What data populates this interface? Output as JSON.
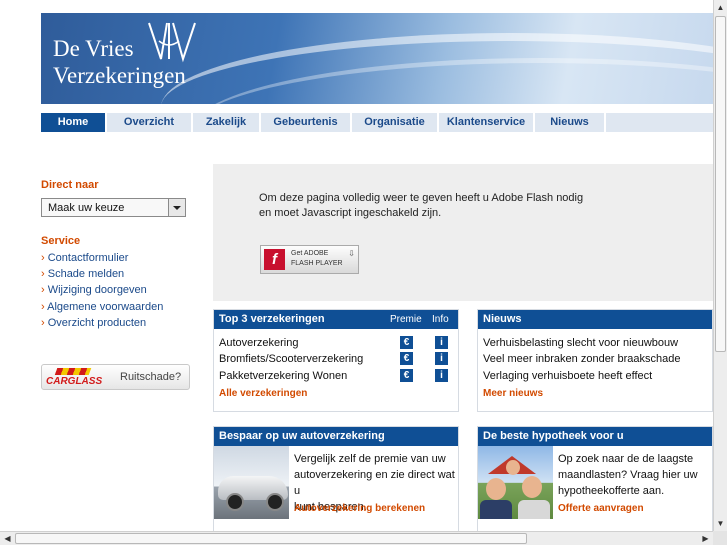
{
  "header": {
    "logo_line1": "De Vries",
    "logo_line2": "Verzekeringen",
    "logo_icon": "dv-monogram-icon"
  },
  "nav": {
    "items": [
      {
        "label": "Home",
        "active": true
      },
      {
        "label": "Overzicht"
      },
      {
        "label": "Zakelijk"
      },
      {
        "label": "Gebeurtenis"
      },
      {
        "label": "Organisatie"
      },
      {
        "label": "Klantenservice"
      },
      {
        "label": "Nieuws"
      }
    ]
  },
  "sidebar": {
    "direct_heading": "Direct naar",
    "select_value": "Maak uw keuze",
    "service_heading": "Service",
    "service_links": [
      "Contactformulier",
      "Schade melden",
      "Wijziging doorgeven",
      "Algemene voorwaarden",
      "Overzicht producten"
    ],
    "carglass_brand": "CARGLASS",
    "carglass_text": "Ruitschade?"
  },
  "flash": {
    "line1": "Om deze pagina volledig weer te geven heeft u Adobe Flash nodig",
    "line2": "en moet Javascript ingeschakeld zijn.",
    "button_line1": "Get ADOBE",
    "button_line2": "FLASH PLAYER"
  },
  "top3": {
    "title": "Top 3 verzekeringen",
    "col_premie": "Premie",
    "col_info": "Info",
    "rows": [
      "Autoverzekering",
      "Bromfiets/Scooterverzekering",
      "Pakketverzekering Wonen"
    ],
    "premie_icon": "€",
    "info_icon": "i",
    "more": "Alle verzekeringen"
  },
  "news": {
    "title": "Nieuws",
    "items": [
      "Verhuisbelasting slecht voor nieuwbouw",
      "Veel meer inbraken zonder braakschade",
      "Verlaging verhuisboete heeft effect"
    ],
    "more": "Meer nieuws"
  },
  "auto_promo": {
    "title": "Bespaar op uw autoverzekering",
    "text_lines": [
      "Vergelijk zelf de premie van uw",
      "autoverzekering en zie direct wat u",
      "kunt besparen."
    ],
    "link": "Autoverzekering berekenen"
  },
  "mortgage_promo": {
    "title": "De beste hypotheek voor u",
    "text_lines": [
      "Op zoek naar de de laagste",
      "maandlasten? Vraag hier uw",
      "hypotheekofferte aan."
    ],
    "link": "Offerte aanvragen"
  }
}
